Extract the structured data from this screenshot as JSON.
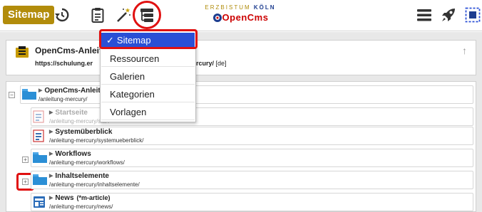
{
  "toolbar": {
    "sitemap_label": "Sitemap",
    "icons": [
      "history-icon",
      "clipboard-icon",
      "magic-wand-icon",
      "sitemap-view-icon",
      "menu-icon",
      "rocket-icon",
      "selection-icon"
    ]
  },
  "logo": {
    "top_left": "ERZBISTUM",
    "top_right": "KÖLN",
    "bottom": "OpenCms"
  },
  "header": {
    "title": "OpenCms-Anleit",
    "url_prefix": "https://schulung.er",
    "url_suffix": "mercury/",
    "locale": "[de]"
  },
  "dropdown": {
    "items": [
      {
        "label": "Sitemap",
        "checked": true
      },
      {
        "label": "Ressourcen"
      },
      {
        "label": "Galerien"
      },
      {
        "label": "Kategorien"
      },
      {
        "label": "Vorlagen"
      }
    ]
  },
  "tree": {
    "rows": [
      {
        "title": "OpenCms-Anleit",
        "path": "/anleitung-mercury/",
        "icon": "folder-icon"
      },
      {
        "title": "Startseite",
        "path": "/anleitung-mercury/start",
        "icon": "page-icon"
      },
      {
        "title": "Systemüberblick",
        "path": "/anleitung-mercury/systemueberblick/",
        "icon": "page-icon"
      },
      {
        "title": "Workflows",
        "path": "/anleitung-mercury/workflows/",
        "icon": "folder-icon"
      },
      {
        "title": "Inhaltselemente",
        "path": "/anleitung-mercury/inhaltselemente/",
        "icon": "folder-icon"
      },
      {
        "title": "News",
        "suffix": "(*m-article)",
        "path": "/anleitung-mercury/news/",
        "icon": "news-icon"
      }
    ]
  },
  "colors": {
    "brand_gold": "#b28c0b",
    "highlight_blue": "#2a4fd6",
    "annotation_red": "#e01010"
  }
}
